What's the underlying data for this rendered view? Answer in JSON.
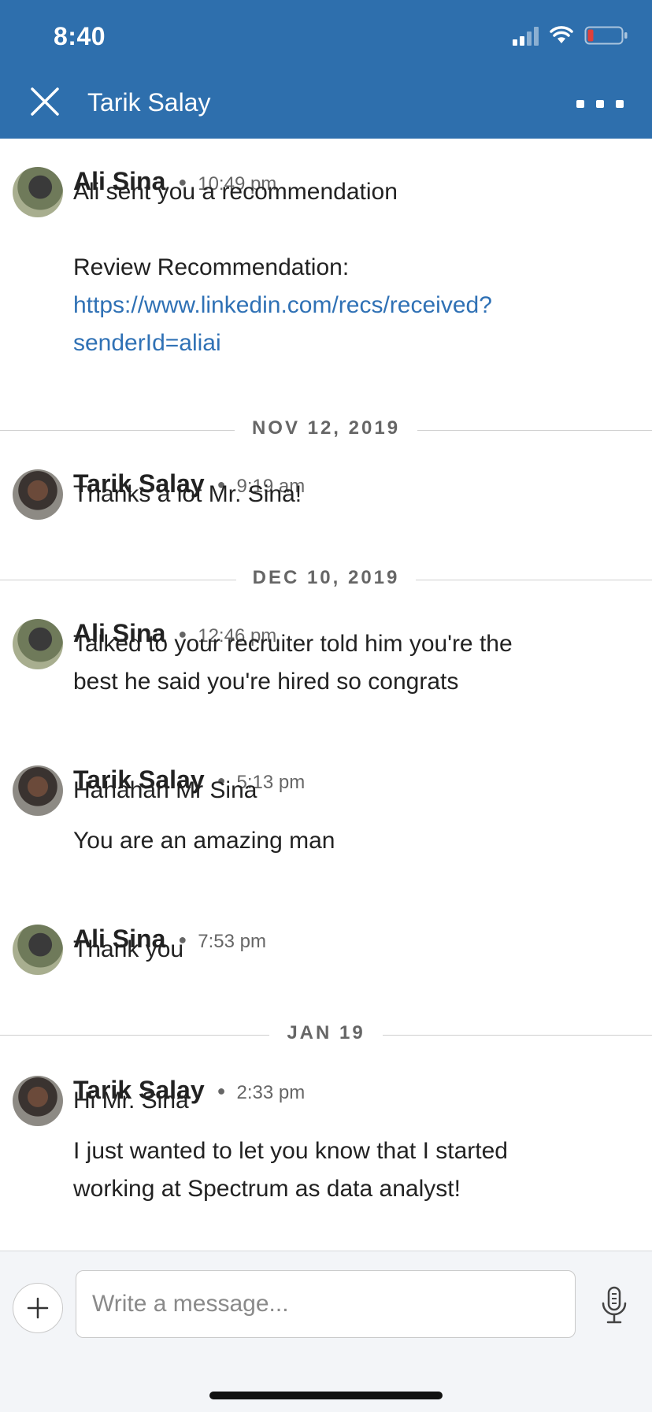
{
  "status_bar": {
    "time": "8:40"
  },
  "header": {
    "title": "Tarik Salay",
    "close_icon": "close-icon",
    "more_icon": "more-icon"
  },
  "thread": {
    "messages": [
      {
        "sender": "Ali Sina",
        "time": "10:49 pm",
        "lines": [
          "Ali sent you a recommendation",
          "",
          "Review Recommendation:"
        ],
        "link_lines": [
          "https://www.linkedin.com/recs/received?",
          "senderId=aliai"
        ]
      },
      {
        "sender": "Tarik Salay",
        "time": "9:19 am",
        "lines": [
          "Thanks a lot Mr. Sina!"
        ]
      },
      {
        "sender": "Ali Sina",
        "time": "12:46 pm",
        "lines": [
          "Talked to your recruiter told him you're the",
          "best he said you're hired so congrats"
        ]
      },
      {
        "sender": "Tarik Salay",
        "time": "5:13 pm",
        "lines": [
          "Hahahah Mr Sina",
          "You are an amazing man"
        ]
      },
      {
        "sender": "Ali Sina",
        "time": "7:53 pm",
        "lines": [
          "Thank you"
        ]
      },
      {
        "sender": "Tarik Salay",
        "time": "2:33 pm",
        "lines": [
          "Hi Mr. Sina",
          "I just wanted to let you know that I started",
          "working at Spectrum as data analyst!"
        ]
      }
    ],
    "dividers": [
      "NOV 12, 2019",
      "DEC 10, 2019",
      "JAN 19"
    ]
  },
  "composer": {
    "placeholder": "Write a message...",
    "value": ""
  },
  "colors": {
    "header_bg": "#2e6fad",
    "link": "#2f71b5"
  }
}
